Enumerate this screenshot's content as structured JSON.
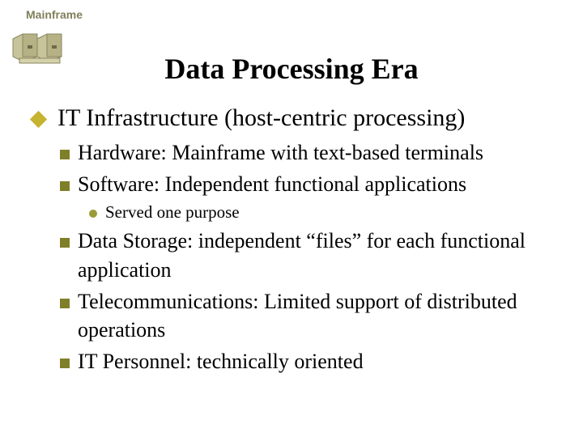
{
  "header": {
    "label": "Mainframe"
  },
  "title": "Data Processing Era",
  "bullets": {
    "l1": "IT Infrastructure (host-centric processing)",
    "l2a": "Hardware: Mainframe with text-based terminals",
    "l2b": "Software:  Independent functional applications",
    "l3a": "Served one purpose",
    "l2c": "Data Storage: independent “files” for each functional application",
    "l2d": "Telecommunications: Limited support of distributed operations",
    "l2e": "IT Personnel: technically oriented"
  },
  "icons": {
    "diamond": "diamond-bullet-icon",
    "square": "square-bullet-icon",
    "dot": "dot-bullet-icon",
    "mainframe": "mainframe-icon"
  },
  "colors": {
    "accent_olive": "#7f7f2a",
    "accent_gold": "#c6b32f"
  }
}
